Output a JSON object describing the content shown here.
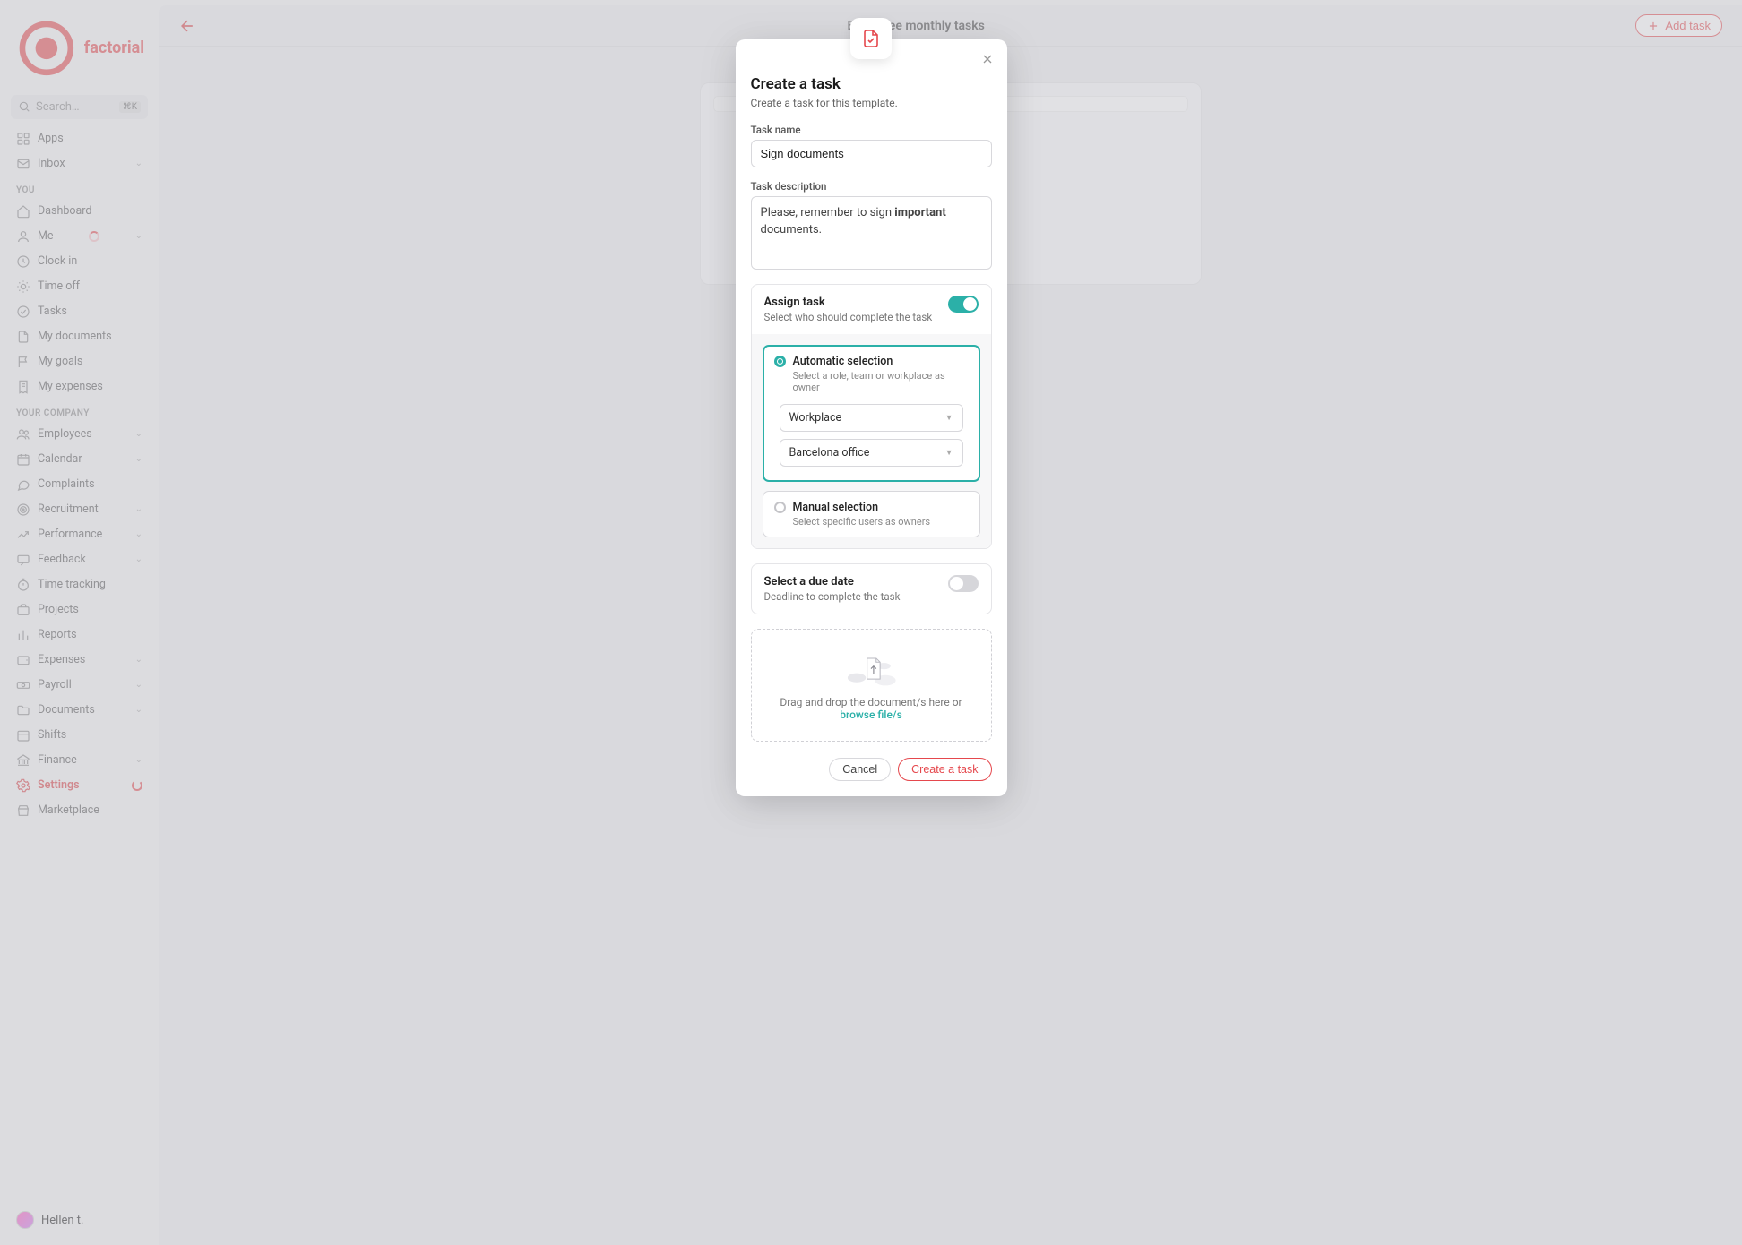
{
  "brand": "factorial",
  "search": {
    "placeholder": "Search…",
    "shortcut": "⌘K"
  },
  "sidebar": {
    "top": [
      {
        "label": "Apps",
        "icon": "grid-icon"
      },
      {
        "label": "Inbox",
        "icon": "mail-icon",
        "chevron": true
      }
    ],
    "you_header": "YOU",
    "you": [
      {
        "label": "Dashboard",
        "icon": "home-icon"
      },
      {
        "label": "Me",
        "icon": "user-icon",
        "spinner": true,
        "chevron": true
      },
      {
        "label": "Clock in",
        "icon": "clock-icon"
      },
      {
        "label": "Time off",
        "icon": "sun-icon"
      },
      {
        "label": "Tasks",
        "icon": "check-circle-icon"
      },
      {
        "label": "My documents",
        "icon": "file-icon"
      },
      {
        "label": "My goals",
        "icon": "flag-icon"
      },
      {
        "label": "My expenses",
        "icon": "receipt-icon"
      }
    ],
    "company_header": "YOUR COMPANY",
    "company": [
      {
        "label": "Employees",
        "icon": "users-icon",
        "chevron": true
      },
      {
        "label": "Calendar",
        "icon": "calendar-icon",
        "chevron": true
      },
      {
        "label": "Complaints",
        "icon": "chat-icon"
      },
      {
        "label": "Recruitment",
        "icon": "target-icon",
        "chevron": true
      },
      {
        "label": "Performance",
        "icon": "trending-icon",
        "chevron": true
      },
      {
        "label": "Feedback",
        "icon": "message-icon",
        "chevron": true
      },
      {
        "label": "Time tracking",
        "icon": "stopwatch-icon"
      },
      {
        "label": "Projects",
        "icon": "briefcase-icon"
      },
      {
        "label": "Reports",
        "icon": "bar-chart-icon"
      },
      {
        "label": "Expenses",
        "icon": "wallet-icon",
        "chevron": true
      },
      {
        "label": "Payroll",
        "icon": "money-icon",
        "chevron": true
      },
      {
        "label": "Documents",
        "icon": "folder-icon",
        "chevron": true
      },
      {
        "label": "Shifts",
        "icon": "calendar2-icon"
      },
      {
        "label": "Finance",
        "icon": "bank-icon",
        "chevron": true
      },
      {
        "label": "Settings",
        "icon": "gear-icon",
        "active": true,
        "settings_spinner": true
      },
      {
        "label": "Marketplace",
        "icon": "shop-icon"
      }
    ]
  },
  "user": {
    "name": "Hellen t."
  },
  "topbar": {
    "title": "Employee monthly tasks",
    "add_task": "Add task"
  },
  "background_card": {
    "hint": ""
  },
  "modal": {
    "title": "Create a task",
    "subtitle": "Create a task for this template.",
    "task_name_label": "Task name",
    "task_name_value": "Sign documents",
    "task_desc_label": "Task description",
    "task_desc_prefix": "Please, remember to sign ",
    "task_desc_bold": "important",
    "task_desc_suffix": " documents.",
    "assign": {
      "title": "Assign task",
      "subtitle": "Select who should complete the task",
      "enabled": true,
      "auto": {
        "title": "Automatic selection",
        "subtitle": "Select a role, team or workplace as owner",
        "selected": true,
        "field1": "Workplace",
        "field2": "Barcelona office"
      },
      "manual": {
        "title": "Manual selection",
        "subtitle": "Select specific users as owners",
        "selected": false
      }
    },
    "due": {
      "title": "Select a due date",
      "subtitle": "Deadline to complete the task",
      "enabled": false
    },
    "dropzone": {
      "text": "Drag and drop the document/s here or",
      "browse": "browse file/s"
    },
    "actions": {
      "cancel": "Cancel",
      "create": "Create a task"
    }
  }
}
